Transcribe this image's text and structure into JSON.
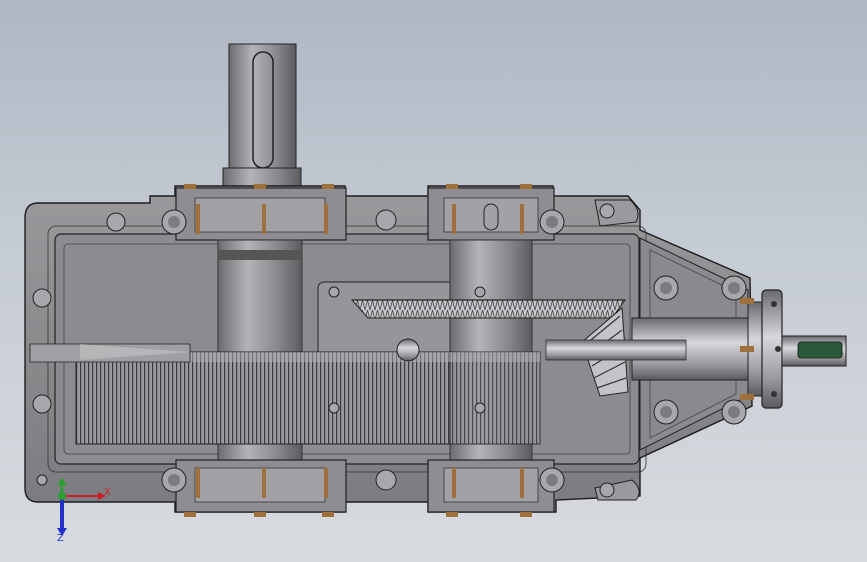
{
  "viewport": {
    "background_top": "#aeb7c4",
    "background_bottom": "#d8dbdf"
  },
  "model": {
    "housing_color": "#8e8e91",
    "housing_edge": "#1c1c1e",
    "shaft_color": "#a4a4a8",
    "gear_color": "#b8b8bc",
    "accent_brass": "#a0703c",
    "keyway_color": "#2a5a3a"
  },
  "triad": {
    "x_label": "X",
    "z_label": "Z",
    "x_color": "#c8202a",
    "y_color": "#2aa030",
    "z_color": "#2030c8"
  }
}
